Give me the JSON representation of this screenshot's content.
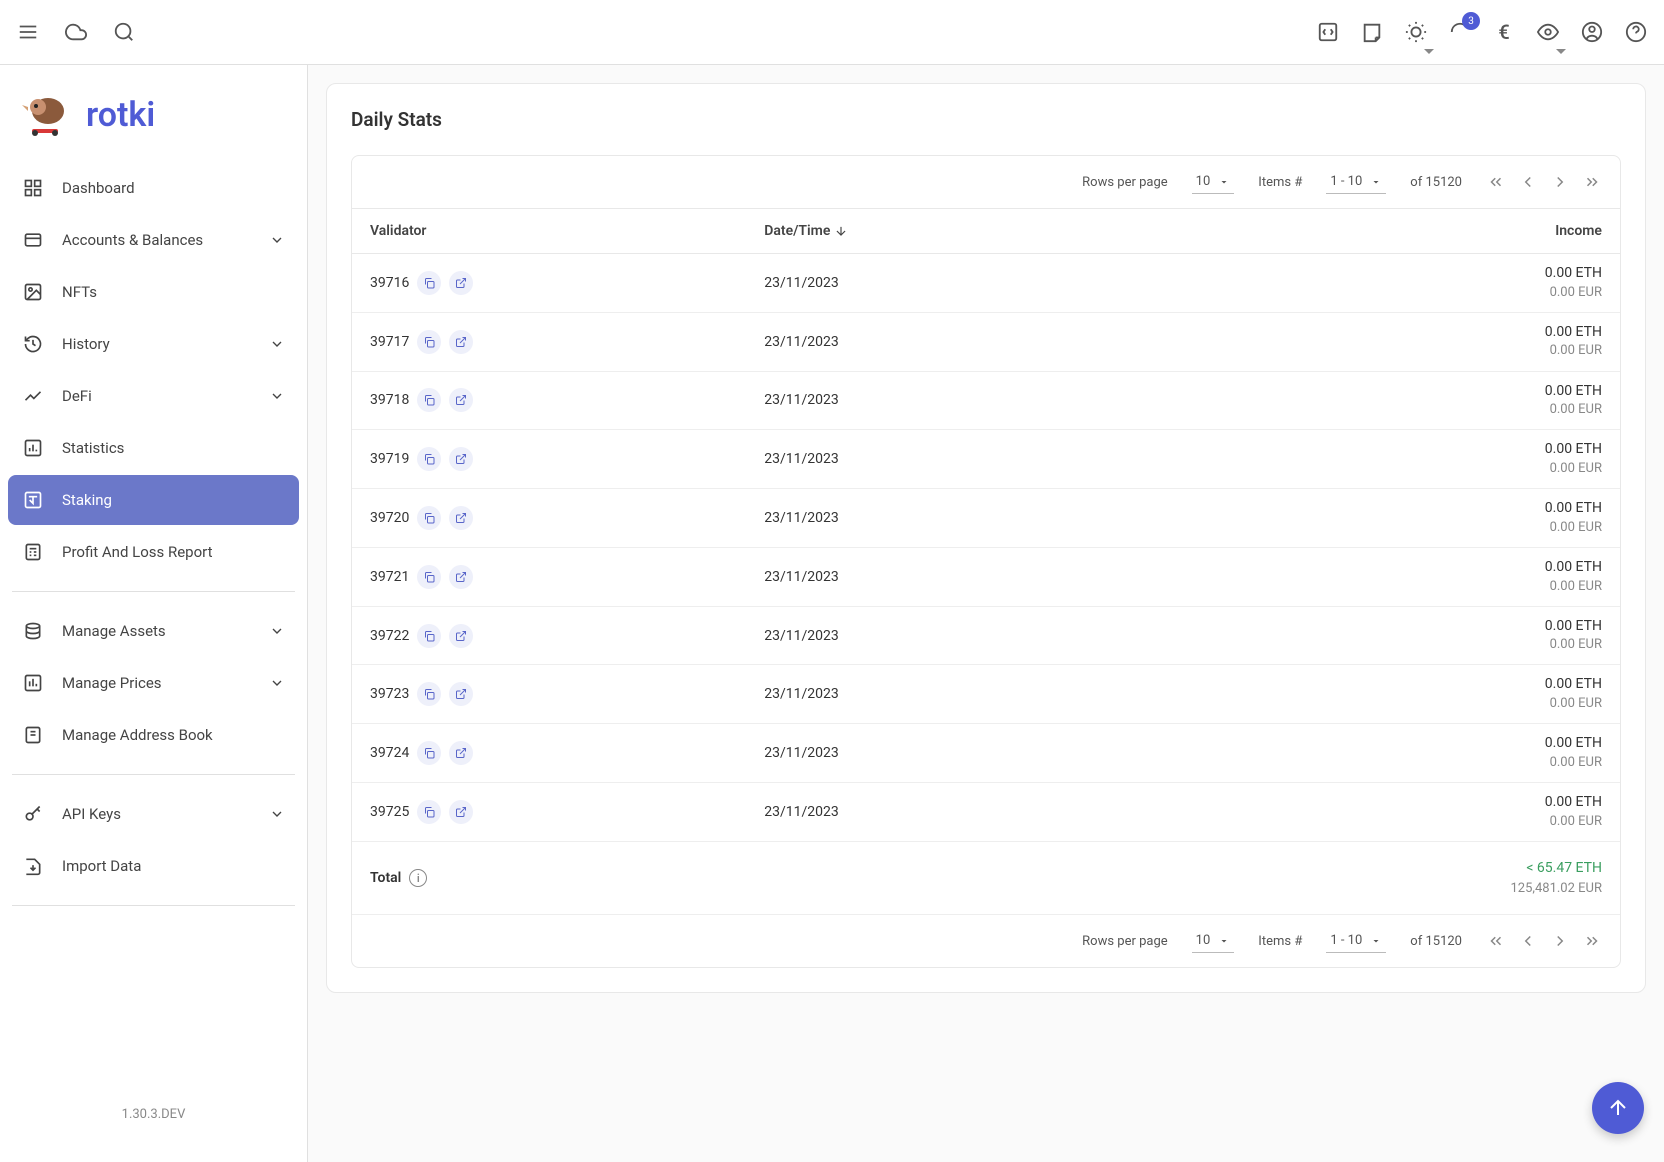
{
  "topbar": {
    "badge_count": "3",
    "currency_symbol": "€"
  },
  "logo": {
    "text": "rotki"
  },
  "sidebar": {
    "items": [
      {
        "label": "Dashboard",
        "expandable": false
      },
      {
        "label": "Accounts & Balances",
        "expandable": true
      },
      {
        "label": "NFTs",
        "expandable": false
      },
      {
        "label": "History",
        "expandable": true
      },
      {
        "label": "DeFi",
        "expandable": true
      },
      {
        "label": "Statistics",
        "expandable": false
      },
      {
        "label": "Staking",
        "expandable": false,
        "active": true
      },
      {
        "label": "Profit And Loss Report",
        "expandable": false
      }
    ],
    "items2": [
      {
        "label": "Manage Assets",
        "expandable": true
      },
      {
        "label": "Manage Prices",
        "expandable": true
      },
      {
        "label": "Manage Address Book",
        "expandable": false
      }
    ],
    "items3": [
      {
        "label": "API Keys",
        "expandable": true
      },
      {
        "label": "Import Data",
        "expandable": false
      }
    ]
  },
  "version": "1.30.3.DEV",
  "card": {
    "title": "Daily Stats"
  },
  "pagination": {
    "rows_label": "Rows per page",
    "rows_value": "10",
    "items_label": "Items #",
    "range": "1 - 10",
    "of_label": "of 15120"
  },
  "table": {
    "headers": {
      "validator": "Validator",
      "datetime": "Date/Time",
      "income": "Income"
    },
    "rows": [
      {
        "validator": "39716",
        "date": "23/11/2023",
        "eth": "0.00 ETH",
        "eur": "0.00 EUR"
      },
      {
        "validator": "39717",
        "date": "23/11/2023",
        "eth": "0.00 ETH",
        "eur": "0.00 EUR"
      },
      {
        "validator": "39718",
        "date": "23/11/2023",
        "eth": "0.00 ETH",
        "eur": "0.00 EUR"
      },
      {
        "validator": "39719",
        "date": "23/11/2023",
        "eth": "0.00 ETH",
        "eur": "0.00 EUR"
      },
      {
        "validator": "39720",
        "date": "23/11/2023",
        "eth": "0.00 ETH",
        "eur": "0.00 EUR"
      },
      {
        "validator": "39721",
        "date": "23/11/2023",
        "eth": "0.00 ETH",
        "eur": "0.00 EUR"
      },
      {
        "validator": "39722",
        "date": "23/11/2023",
        "eth": "0.00 ETH",
        "eur": "0.00 EUR"
      },
      {
        "validator": "39723",
        "date": "23/11/2023",
        "eth": "0.00 ETH",
        "eur": "0.00 EUR"
      },
      {
        "validator": "39724",
        "date": "23/11/2023",
        "eth": "0.00 ETH",
        "eur": "0.00 EUR"
      },
      {
        "validator": "39725",
        "date": "23/11/2023",
        "eth": "0.00 ETH",
        "eur": "0.00 EUR"
      }
    ],
    "footer": {
      "total_label": "Total",
      "total_eth": "< 65.47 ETH",
      "total_eur": "125,481.02 EUR"
    }
  }
}
